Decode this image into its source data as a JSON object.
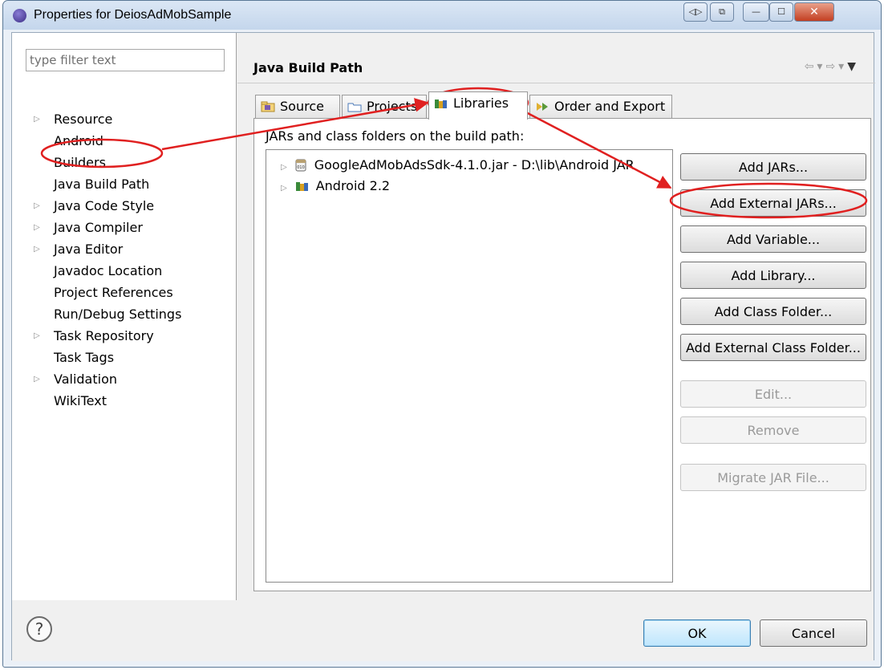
{
  "window": {
    "title": "Properties for DeiosAdMobSample",
    "controls": {
      "back": "◁▷",
      "restore": "⧉",
      "minimize": "—",
      "maximize": "☐",
      "close": "✕"
    }
  },
  "filter": {
    "placeholder": "type filter text",
    "value": ""
  },
  "tree": [
    {
      "label": "Resource",
      "expandable": true
    },
    {
      "label": "Android",
      "expandable": false
    },
    {
      "label": "Builders",
      "expandable": false
    },
    {
      "label": "Java Build Path",
      "expandable": false,
      "selected": true
    },
    {
      "label": "Java Code Style",
      "expandable": true
    },
    {
      "label": "Java Compiler",
      "expandable": true
    },
    {
      "label": "Java Editor",
      "expandable": true
    },
    {
      "label": "Javadoc Location",
      "expandable": false
    },
    {
      "label": "Project References",
      "expandable": false
    },
    {
      "label": "Run/Debug Settings",
      "expandable": false
    },
    {
      "label": "Task Repository",
      "expandable": true
    },
    {
      "label": "Task Tags",
      "expandable": false
    },
    {
      "label": "Validation",
      "expandable": true
    },
    {
      "label": "WikiText",
      "expandable": false
    }
  ],
  "page": {
    "title": "Java Build Path",
    "tabs": [
      {
        "label": "Source"
      },
      {
        "label": "Projects"
      },
      {
        "label": "Libraries",
        "active": true
      },
      {
        "label": "Order and Export"
      }
    ],
    "list_label": "JARs and class folders on the build path:",
    "entries": [
      {
        "label": "GoogleAdMobAdsSdk-4.1.0.jar - D:\\lib\\Android JAR",
        "icon": "jar-icon"
      },
      {
        "label": "Android 2.2",
        "icon": "library-icon"
      }
    ],
    "buttons": [
      {
        "label": "Add JARs...",
        "enabled": true
      },
      {
        "label": "Add External JARs...",
        "enabled": true
      },
      {
        "label": "Add Variable...",
        "enabled": true
      },
      {
        "label": "Add Library...",
        "enabled": true
      },
      {
        "label": "Add Class Folder...",
        "enabled": true
      },
      {
        "label": "Add External Class Folder...",
        "enabled": true
      },
      {
        "label": "Edit...",
        "enabled": false
      },
      {
        "label": "Remove",
        "enabled": false
      },
      {
        "label": "Migrate JAR File...",
        "enabled": false
      }
    ]
  },
  "footer": {
    "help": "?",
    "ok": "OK",
    "cancel": "Cancel"
  },
  "colors": {
    "annotation": "#e02020",
    "window_frame": "#c4d6ec",
    "default_button": "#bee6fd"
  }
}
